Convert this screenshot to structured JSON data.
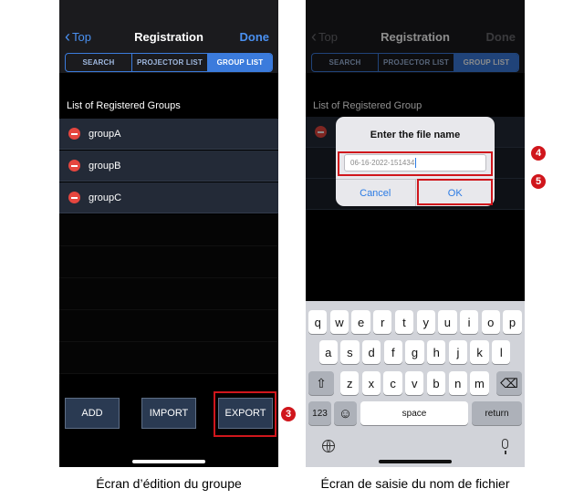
{
  "left_screen": {
    "nav": {
      "back_label": "Top",
      "title": "Registration",
      "done_label": "Done"
    },
    "segments": [
      "SEARCH",
      "PROJECTOR LIST",
      "GROUP LIST"
    ],
    "active_segment": "GROUP LIST",
    "list_header": "List of Registered Groups",
    "groups": [
      "groupA",
      "groupB",
      "groupC"
    ],
    "buttons": {
      "add": "ADD",
      "import": "IMPORT",
      "export": "EXPORT"
    },
    "callout": "3",
    "caption": "Écran d’édition du groupe"
  },
  "right_screen": {
    "nav": {
      "back_label": "Top",
      "title": "Registration",
      "done_label": "Done"
    },
    "segments": [
      "SEARCH",
      "PROJECTOR LIST",
      "GROUP LIST"
    ],
    "active_segment": "GROUP LIST",
    "list_header": "List of Registered Group",
    "dialog": {
      "title": "Enter the file name",
      "input_value": "06-16-2022-151434",
      "cancel": "Cancel",
      "ok": "OK"
    },
    "keyboard": {
      "row1": [
        "q",
        "w",
        "e",
        "r",
        "t",
        "y",
        "u",
        "i",
        "o",
        "p"
      ],
      "row2": [
        "a",
        "s",
        "d",
        "f",
        "g",
        "h",
        "j",
        "k",
        "l"
      ],
      "row3": [
        "z",
        "x",
        "c",
        "v",
        "b",
        "n",
        "m"
      ],
      "shift_glyph": "⇧",
      "delete_glyph": "⌫",
      "numbers": "123",
      "emoji_glyph": "☺",
      "space": "space",
      "return": "return"
    },
    "callouts": [
      "4",
      "5"
    ],
    "caption": "Écran de saisie du nom de fichier"
  },
  "colors": {
    "accent": "#3b7bdc",
    "highlight": "#d0161c",
    "row_bg": "#232a37",
    "button_bg": "#2a3a52"
  }
}
